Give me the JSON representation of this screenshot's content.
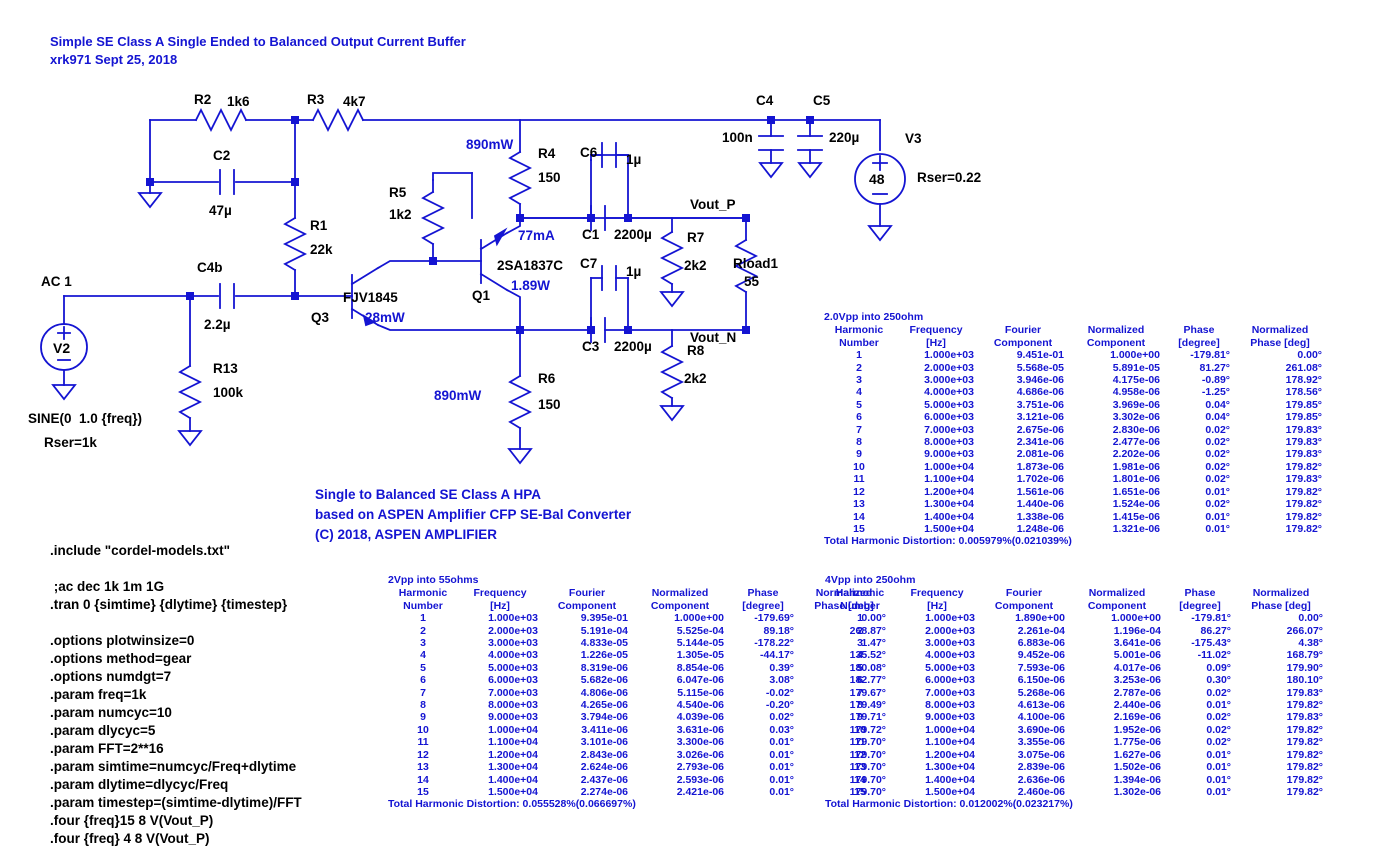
{
  "document": {
    "title_line1": "Simple SE Class A Single Ended to Balanced Output Current Buffer",
    "title_line2": "xrk971 Sept 25, 2018",
    "credit_line1": "Single to Balanced SE Class A HPA",
    "credit_line2": "based on ASPEN Amplifier CFP SE-Bal Converter",
    "credit_line3": "(C) 2018, ASPEN AMPLIFIER",
    "colors": {
      "wire": "#1414d2",
      "blue_text": "#1414d2",
      "black_text": "#000000",
      "background": "#ffffff"
    }
  },
  "schematic": {
    "components": {
      "R2": {
        "ref": "R2",
        "value": "1k6"
      },
      "R3": {
        "ref": "R3",
        "value": "4k7"
      },
      "C2": {
        "ref": "C2",
        "value": "47µ"
      },
      "R1": {
        "ref": "R1",
        "value": "22k"
      },
      "C4b": {
        "ref": "C4b",
        "value": "2.2µ"
      },
      "R13": {
        "ref": "R13",
        "value": "100k"
      },
      "R5": {
        "ref": "R5",
        "value": "1k2"
      },
      "R4": {
        "ref": "R4",
        "value": "150"
      },
      "R6": {
        "ref": "R6",
        "value": "150"
      },
      "C6": {
        "ref": "C6",
        "value": "1µ"
      },
      "C7": {
        "ref": "C7",
        "value": "1µ"
      },
      "C1": {
        "ref": "C1",
        "value": "2200µ"
      },
      "C3": {
        "ref": "C3",
        "value": "2200µ"
      },
      "C4": {
        "ref": "C4",
        "value": "100n"
      },
      "C5": {
        "ref": "C5",
        "value": "220µ"
      },
      "R7": {
        "ref": "R7",
        "value": "2k2"
      },
      "R8": {
        "ref": "R8",
        "value": "2k2"
      },
      "Rload1": {
        "ref": "Rload1",
        "value": "55"
      },
      "Q3": {
        "ref": "Q3",
        "part": "FJV1845",
        "power": "28mW"
      },
      "Q1": {
        "ref": "Q1",
        "part": "2SA1837C",
        "power": "1.89W",
        "current": "77mA"
      },
      "V2": {
        "ref": "V2",
        "ac": "AC 1",
        "sine": "SINE(0  1.0 {freq})",
        "rser": "Rser=1k"
      },
      "V3": {
        "ref": "V3",
        "value": "48",
        "rser": "Rser=0.22"
      }
    },
    "annotations": {
      "r4_power": "890mW",
      "r6_power": "890mW",
      "q1_current": "77mA",
      "q1_power": "1.89W",
      "q3_power": "28mW"
    },
    "nets": {
      "vout_p": "Vout_P",
      "vout_n": "Vout_N"
    }
  },
  "spice_directives": [
    ".include \"cordel-models.txt\"",
    "",
    " ;ac dec 1k 1m 1G",
    ".tran 0 {simtime} {dlytime} {timestep}",
    "",
    ".options plotwinsize=0",
    ".options method=gear",
    ".options numdgt=7",
    ".param freq=1k",
    ".param numcyc=10",
    ".param dlycyc=5",
    ".param FFT=2**16",
    ".param simtime=numcyc/Freq+dlytime",
    ".param dlytime=dlycyc/Freq",
    ".param timestep=(simtime-dlytime)/FFT",
    ".four {freq}15 8 V(Vout_P)",
    ".four {freq} 4 8 V(Vout_P)"
  ],
  "fourier_headers": [
    "Harmonic\nNumber",
    "Frequency\n[Hz]",
    "Fourier\nComponent",
    "Normalized\nComponent",
    "Phase\n[degree]",
    "Normalized\nPhase [deg]"
  ],
  "fourier_tables": [
    {
      "id": "table-2vpp-250ohm",
      "caption": "2.0Vpp into 250ohm",
      "thd_label": "Total Harmonic Distortion: 0.005979%(0.021039%)",
      "rows": [
        [
          "1",
          "1.000e+03",
          "9.451e-01",
          "1.000e+00",
          "-179.81°",
          "0.00°"
        ],
        [
          "2",
          "2.000e+03",
          "5.568e-05",
          "5.891e-05",
          "81.27°",
          "261.08°"
        ],
        [
          "3",
          "3.000e+03",
          "3.946e-06",
          "4.175e-06",
          "-0.89°",
          "178.92°"
        ],
        [
          "4",
          "4.000e+03",
          "4.686e-06",
          "4.958e-06",
          "-1.25°",
          "178.56°"
        ],
        [
          "5",
          "5.000e+03",
          "3.751e-06",
          "3.969e-06",
          "0.04°",
          "179.85°"
        ],
        [
          "6",
          "6.000e+03",
          "3.121e-06",
          "3.302e-06",
          "0.04°",
          "179.85°"
        ],
        [
          "7",
          "7.000e+03",
          "2.675e-06",
          "2.830e-06",
          "0.02°",
          "179.83°"
        ],
        [
          "8",
          "8.000e+03",
          "2.341e-06",
          "2.477e-06",
          "0.02°",
          "179.83°"
        ],
        [
          "9",
          "9.000e+03",
          "2.081e-06",
          "2.202e-06",
          "0.02°",
          "179.83°"
        ],
        [
          "10",
          "1.000e+04",
          "1.873e-06",
          "1.981e-06",
          "0.02°",
          "179.82°"
        ],
        [
          "11",
          "1.100e+04",
          "1.702e-06",
          "1.801e-06",
          "0.02°",
          "179.83°"
        ],
        [
          "12",
          "1.200e+04",
          "1.561e-06",
          "1.651e-06",
          "0.01°",
          "179.82°"
        ],
        [
          "13",
          "1.300e+04",
          "1.440e-06",
          "1.524e-06",
          "0.02°",
          "179.82°"
        ],
        [
          "14",
          "1.400e+04",
          "1.338e-06",
          "1.415e-06",
          "0.01°",
          "179.82°"
        ],
        [
          "15",
          "1.500e+04",
          "1.248e-06",
          "1.321e-06",
          "0.01°",
          "179.82°"
        ]
      ]
    },
    {
      "id": "table-2vpp-55ohms",
      "caption": "2Vpp into 55ohms",
      "thd_label": "Total Harmonic Distortion: 0.055528%(0.066697%)",
      "rows": [
        [
          "1",
          "1.000e+03",
          "9.395e-01",
          "1.000e+00",
          "-179.69°",
          "0.00°"
        ],
        [
          "2",
          "2.000e+03",
          "5.191e-04",
          "5.525e-04",
          "89.18°",
          "268.87°"
        ],
        [
          "3",
          "3.000e+03",
          "4.833e-05",
          "5.144e-05",
          "-178.22°",
          "1.47°"
        ],
        [
          "4",
          "4.000e+03",
          "1.226e-05",
          "1.305e-05",
          "-44.17°",
          "135.52°"
        ],
        [
          "5",
          "5.000e+03",
          "8.319e-06",
          "8.854e-06",
          "0.39°",
          "180.08°"
        ],
        [
          "6",
          "6.000e+03",
          "5.682e-06",
          "6.047e-06",
          "3.08°",
          "182.77°"
        ],
        [
          "7",
          "7.000e+03",
          "4.806e-06",
          "5.115e-06",
          "-0.02°",
          "179.67°"
        ],
        [
          "8",
          "8.000e+03",
          "4.265e-06",
          "4.540e-06",
          "-0.20°",
          "179.49°"
        ],
        [
          "9",
          "9.000e+03",
          "3.794e-06",
          "4.039e-06",
          "0.02°",
          "179.71°"
        ],
        [
          "10",
          "1.000e+04",
          "3.411e-06",
          "3.631e-06",
          "0.03°",
          "179.72°"
        ],
        [
          "11",
          "1.100e+04",
          "3.101e-06",
          "3.300e-06",
          "0.01°",
          "179.70°"
        ],
        [
          "12",
          "1.200e+04",
          "2.843e-06",
          "3.026e-06",
          "0.01°",
          "179.70°"
        ],
        [
          "13",
          "1.300e+04",
          "2.624e-06",
          "2.793e-06",
          "0.01°",
          "179.70°"
        ],
        [
          "14",
          "1.400e+04",
          "2.437e-06",
          "2.593e-06",
          "0.01°",
          "179.70°"
        ],
        [
          "15",
          "1.500e+04",
          "2.274e-06",
          "2.421e-06",
          "0.01°",
          "179.70°"
        ]
      ]
    },
    {
      "id": "table-4vpp-250ohm",
      "caption": "4Vpp into 250ohm",
      "thd_label": "Total Harmonic Distortion: 0.012002%(0.023217%)",
      "rows": [
        [
          "1",
          "1.000e+03",
          "1.890e+00",
          "1.000e+00",
          "-179.81°",
          "0.00°"
        ],
        [
          "2",
          "2.000e+03",
          "2.261e-04",
          "1.196e-04",
          "86.27°",
          "266.07°"
        ],
        [
          "3",
          "3.000e+03",
          "6.883e-06",
          "3.641e-06",
          "-175.43°",
          "4.38°"
        ],
        [
          "4",
          "4.000e+03",
          "9.452e-06",
          "5.001e-06",
          "-11.02°",
          "168.79°"
        ],
        [
          "5",
          "5.000e+03",
          "7.593e-06",
          "4.017e-06",
          "0.09°",
          "179.90°"
        ],
        [
          "6",
          "6.000e+03",
          "6.150e-06",
          "3.253e-06",
          "0.30°",
          "180.10°"
        ],
        [
          "7",
          "7.000e+03",
          "5.268e-06",
          "2.787e-06",
          "0.02°",
          "179.83°"
        ],
        [
          "8",
          "8.000e+03",
          "4.613e-06",
          "2.440e-06",
          "0.01°",
          "179.82°"
        ],
        [
          "9",
          "9.000e+03",
          "4.100e-06",
          "2.169e-06",
          "0.02°",
          "179.83°"
        ],
        [
          "10",
          "1.000e+04",
          "3.690e-06",
          "1.952e-06",
          "0.02°",
          "179.82°"
        ],
        [
          "11",
          "1.100e+04",
          "3.355e-06",
          "1.775e-06",
          "0.02°",
          "179.82°"
        ],
        [
          "12",
          "1.200e+04",
          "3.075e-06",
          "1.627e-06",
          "0.01°",
          "179.82°"
        ],
        [
          "13",
          "1.300e+04",
          "2.839e-06",
          "1.502e-06",
          "0.01°",
          "179.82°"
        ],
        [
          "14",
          "1.400e+04",
          "2.636e-06",
          "1.394e-06",
          "0.01°",
          "179.82°"
        ],
        [
          "15",
          "1.500e+04",
          "2.460e-06",
          "1.302e-06",
          "0.01°",
          "179.82°"
        ]
      ]
    }
  ]
}
